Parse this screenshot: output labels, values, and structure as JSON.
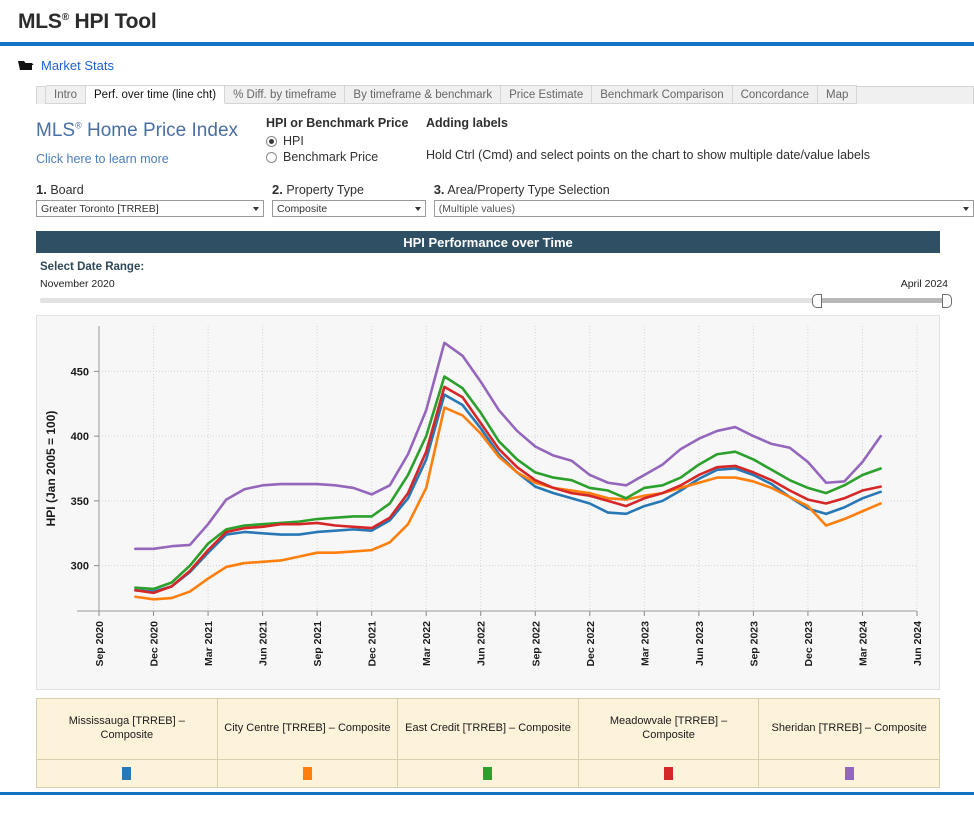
{
  "header": {
    "title_main": "MLS",
    "title_sup": "®",
    "title_rest": " HPI Tool",
    "accent_color": "#1573c6"
  },
  "breadcrumb": {
    "icon": "folder-icon",
    "label": "Market Stats"
  },
  "tabs": [
    {
      "label": "Intro",
      "active": false
    },
    {
      "label": "Perf. over time (line cht)",
      "active": true
    },
    {
      "label": "% Diff. by timeframe",
      "active": false
    },
    {
      "label": "By timeframe & benchmark",
      "active": false
    },
    {
      "label": "Price Estimate",
      "active": false
    },
    {
      "label": "Benchmark Comparison",
      "active": false
    },
    {
      "label": "Concordance",
      "active": false
    },
    {
      "label": "Map",
      "active": false
    }
  ],
  "brand": {
    "title_main": "MLS",
    "title_sup": "®",
    "title_rest": " Home Price Index",
    "link": "Click here to learn more"
  },
  "price_mode": {
    "group_title": "HPI or Benchmark Price",
    "options": [
      {
        "label": "HPI",
        "selected": true
      },
      {
        "label": "Benchmark Price",
        "selected": false
      }
    ]
  },
  "labels_help": {
    "title": "Adding labels",
    "text": "Hold Ctrl (Cmd) and select points on the chart to show multiple date/value labels"
  },
  "filters": {
    "board": {
      "number": "1.",
      "label": " Board",
      "value": "Greater Toronto [TRREB]"
    },
    "property_type": {
      "number": "2.",
      "label": " Property Type",
      "value": "Composite"
    },
    "area_selection": {
      "number": "3.",
      "label": " Area/Property Type Selection",
      "value": "(Multiple values)"
    }
  },
  "chart_band_title": "HPI Performance over Time",
  "date_range": {
    "title": "Select Date Range:",
    "start": "November 2020",
    "end": "April 2024"
  },
  "chart_data": {
    "type": "line",
    "title": "HPI Performance over Time",
    "xlabel": "",
    "ylabel": "HPI (Jan 2005 = 100)",
    "ylim": [
      265,
      485
    ],
    "yticks": [
      300,
      350,
      400,
      450
    ],
    "xticks": [
      "Sep 2020",
      "Dec 2020",
      "Mar 2021",
      "Jun 2021",
      "Sep 2021",
      "Dec 2021",
      "Mar 2022",
      "Jun 2022",
      "Sep 2022",
      "Dec 2022",
      "Mar 2023",
      "Jun 2023",
      "Sep 2023",
      "Dec 2023",
      "Mar 2024",
      "Jun 2024"
    ],
    "grid": true,
    "legend_position": "bottom-table",
    "x": [
      "Nov 2020",
      "Dec 2020",
      "Jan 2021",
      "Feb 2021",
      "Mar 2021",
      "Apr 2021",
      "May 2021",
      "Jun 2021",
      "Jul 2021",
      "Aug 2021",
      "Sep 2021",
      "Oct 2021",
      "Nov 2021",
      "Dec 2021",
      "Jan 2022",
      "Feb 2022",
      "Mar 2022",
      "Apr 2022",
      "May 2022",
      "Jun 2022",
      "Jul 2022",
      "Aug 2022",
      "Sep 2022",
      "Oct 2022",
      "Nov 2022",
      "Dec 2022",
      "Jan 2023",
      "Feb 2023",
      "Mar 2023",
      "Apr 2023",
      "May 2023",
      "Jun 2023",
      "Jul 2023",
      "Aug 2023",
      "Sep 2023",
      "Oct 2023",
      "Nov 2023",
      "Dec 2023",
      "Jan 2024",
      "Feb 2024",
      "Mar 2024",
      "Apr 2024"
    ],
    "series": [
      {
        "name": "Mississauga [TRREB] – Composite",
        "color": "#2878b5",
        "values": [
          281,
          280,
          284,
          295,
          310,
          324,
          326,
          325,
          324,
          324,
          326,
          327,
          328,
          327,
          335,
          352,
          382,
          432,
          424,
          406,
          386,
          372,
          361,
          356,
          352,
          348,
          341,
          340,
          346,
          350,
          358,
          367,
          374,
          375,
          370,
          363,
          353,
          344,
          340,
          345,
          352,
          357
        ]
      },
      {
        "name": "City Centre [TRREB] – Composite",
        "color": "#ff7f0e",
        "values": [
          276,
          274,
          275,
          280,
          290,
          299,
          302,
          303,
          304,
          307,
          310,
          310,
          311,
          312,
          318,
          332,
          360,
          422,
          416,
          402,
          384,
          372,
          364,
          360,
          358,
          356,
          352,
          351,
          354,
          356,
          360,
          364,
          368,
          368,
          365,
          360,
          353,
          346,
          331,
          336,
          342,
          348
        ]
      },
      {
        "name": "East Credit [TRREB] – Composite",
        "color": "#2ca02c",
        "values": [
          283,
          282,
          287,
          300,
          317,
          328,
          331,
          332,
          333,
          334,
          336,
          337,
          338,
          338,
          348,
          370,
          400,
          446,
          437,
          418,
          396,
          382,
          372,
          368,
          366,
          360,
          358,
          352,
          360,
          362,
          368,
          378,
          386,
          388,
          382,
          374,
          366,
          360,
          356,
          362,
          370,
          375
        ]
      },
      {
        "name": "Meadowvale [TRREB] – Composite",
        "color": "#d62728",
        "values": [
          281,
          279,
          284,
          296,
          312,
          326,
          329,
          330,
          332,
          332,
          333,
          331,
          330,
          329,
          337,
          356,
          388,
          438,
          430,
          410,
          390,
          376,
          366,
          360,
          356,
          354,
          350,
          346,
          352,
          356,
          362,
          370,
          376,
          377,
          372,
          366,
          358,
          351,
          348,
          352,
          358,
          361
        ]
      },
      {
        "name": "Sheridan [TRREB] – Composite",
        "color": "#9467bd",
        "values": [
          313,
          313,
          315,
          316,
          332,
          351,
          359,
          362,
          363,
          363,
          363,
          362,
          360,
          355,
          362,
          386,
          420,
          472,
          462,
          442,
          420,
          404,
          392,
          385,
          381,
          370,
          364,
          362,
          370,
          378,
          390,
          398,
          404,
          407,
          400,
          394,
          391,
          380,
          364,
          365,
          380,
          400
        ]
      }
    ]
  },
  "legend": {
    "items": [
      {
        "name": "Mississauga [TRREB] – Composite",
        "color": "#2878b5"
      },
      {
        "name": "City Centre [TRREB] – Composite",
        "color": "#ff7f0e"
      },
      {
        "name": "East Credit [TRREB] – Composite",
        "color": "#2ca02c"
      },
      {
        "name": "Meadowvale [TRREB] – Composite",
        "color": "#d62728"
      },
      {
        "name": "Sheridan [TRREB] – Composite",
        "color": "#9467bd"
      }
    ]
  }
}
